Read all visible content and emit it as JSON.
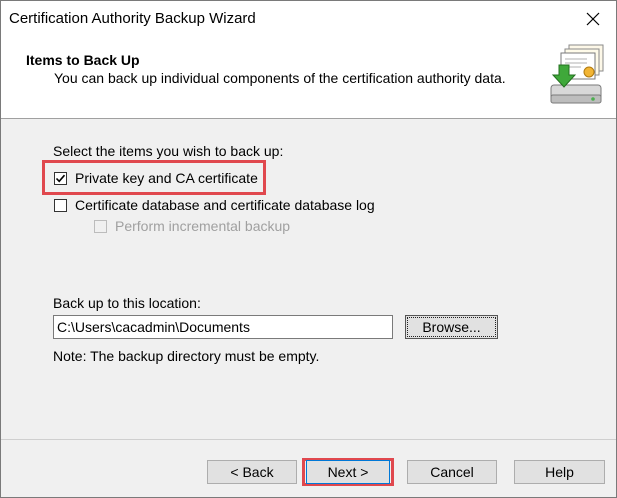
{
  "window": {
    "title": "Certification Authority Backup Wizard"
  },
  "header": {
    "title": "Items to Back Up",
    "subtitle": "You can back up individual components of the certification authority data."
  },
  "items": {
    "prompt": "Select the items you wish to back up:",
    "private_key": {
      "label": "Private key and CA certificate",
      "checked": true
    },
    "cert_db": {
      "label": "Certificate database and certificate database log",
      "checked": false
    },
    "incremental": {
      "label": "Perform incremental backup",
      "checked": false,
      "disabled": true
    }
  },
  "location": {
    "label": "Back up to this location:",
    "value": "C:\\Users\\cacadmin\\Documents",
    "browse_label": "Browse...",
    "note": "Note: The backup directory must be empty."
  },
  "footer": {
    "back_label": "< Back",
    "next_label": "Next >",
    "cancel_label": "Cancel",
    "help_label": "Help"
  },
  "colors": {
    "highlight": "#e0484e",
    "dialog_bg": "#f0f0f0",
    "button_bg": "#e1e1e1"
  }
}
